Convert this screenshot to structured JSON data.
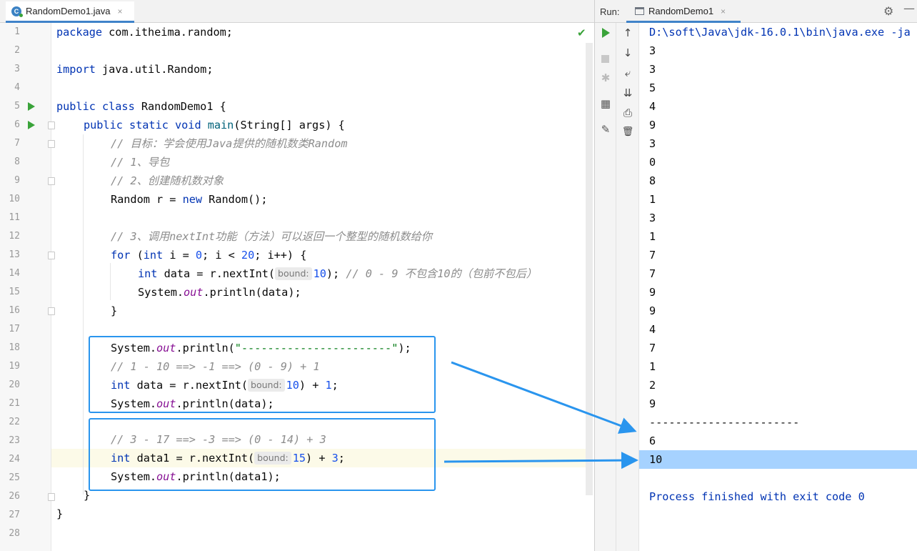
{
  "editor": {
    "tab": {
      "label": "RandomDemo1.java",
      "close": "×",
      "icon_letter": "C"
    },
    "line_numbers": [
      "1",
      "2",
      "3",
      "4",
      "5",
      "6",
      "7",
      "8",
      "9",
      "10",
      "11",
      "12",
      "13",
      "14",
      "15",
      "16",
      "17",
      "18",
      "19",
      "20",
      "21",
      "22",
      "23",
      "24",
      "25",
      "26",
      "27",
      "28"
    ],
    "code": {
      "l1_kw": "package",
      "l1_rest": " com.itheima.random;",
      "l3_kw": "import",
      "l3_rest": " java.util.Random;",
      "l5_kw": "public class",
      "l5_rest": " RandomDemo1 {",
      "l6_kw": "public static void",
      "l6_m": "main",
      "l6_rest": "(String[] args) {",
      "l7_cm": "// 目标：学会使用Java提供的随机数类Random",
      "l8_cm": "// 1、导包",
      "l9_cm": "// 2、创建随机数对象",
      "l10_a": "Random r = ",
      "l10_kw": "new",
      "l10_b": " Random();",
      "l12_cm": "// 3、调用nextInt功能（方法）可以返回一个整型的随机数给你",
      "l13_kw1": "for",
      "l13_a": " (",
      "l13_kw2": "int",
      "l13_b": " i = ",
      "l13_n1": "0",
      "l13_c": "; i < ",
      "l13_n2": "20",
      "l13_d": "; i++) {",
      "l14_kw": "int",
      "l14_a": " data = r.nextInt(",
      "l14_hint": "bound:",
      "l14_n": "10",
      "l14_b": "); ",
      "l14_cm": "// 0 - 9 不包含10的（包前不包后）",
      "l15_a": "System.",
      "l15_f": "out",
      "l15_b": ".println(data);",
      "l16": "}",
      "l18_a": "System.",
      "l18_f": "out",
      "l18_b": ".println(",
      "l18_s": "\"-----------------------\"",
      "l18_c": ");",
      "l19_cm": "// 1 - 10 ==> -1 ==> (0 - 9) + 1",
      "l20_kw": "int",
      "l20_a": " data = r.nextInt(",
      "l20_hint": "bound:",
      "l20_n": "10",
      "l20_b": ") + ",
      "l20_n2": "1",
      "l20_c": ";",
      "l21_a": "System.",
      "l21_f": "out",
      "l21_b": ".println(data);",
      "l23_cm": "// 3 - 17 ==> -3 ==> (0 - 14) + 3",
      "l24_kw": "int",
      "l24_a": " data1 = r.nextInt(",
      "l24_hint": "bound:",
      "l24_n": "15",
      "l24_b": ") + ",
      "l24_n2": "3",
      "l24_c": ";",
      "l25_a": "System.",
      "l25_f": "out",
      "l25_b": ".println(data1);",
      "l26": "}",
      "l27": "}"
    },
    "check_glyph": "✔"
  },
  "run_panel": {
    "label": "Run:",
    "tab_label": "RandomDemo1",
    "tab_close": "×",
    "gear": "⚙",
    "minimize": "—",
    "tools_col2": [
      "↑",
      "↓",
      "⤶",
      "⇊",
      "⎙",
      "🗑"
    ],
    "console": {
      "command": "D:\\soft\\Java\\jdk-16.0.1\\bin\\java.exe -ja",
      "outputs": [
        "3",
        "3",
        "5",
        "4",
        "9",
        "3",
        "0",
        "8",
        "1",
        "3",
        "1",
        "7",
        "7",
        "9",
        "9",
        "4",
        "7",
        "1",
        "2",
        "9"
      ],
      "separator": "-----------------------",
      "after": [
        "6",
        "10"
      ],
      "finished": "Process finished with exit code 0"
    }
  },
  "colors": {
    "keyword": "#0033b3",
    "number": "#1750eb",
    "string": "#067d17",
    "comment": "#8c8c8c",
    "annotation_box": "#2a95ee",
    "selection": "#a6d2ff"
  }
}
